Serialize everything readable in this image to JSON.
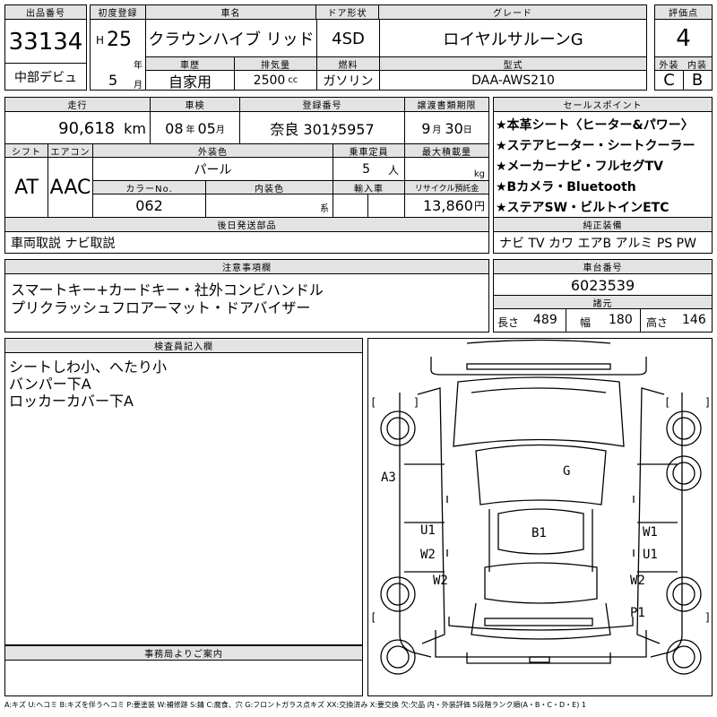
{
  "header": {
    "lot_no_label": "出品番号",
    "lot_no": "33134",
    "auction_label": "中部デビュ",
    "first_reg_label": "初度登録",
    "era": "H",
    "year": "25",
    "year_unit": "年",
    "month": "5",
    "month_unit": "月",
    "car_name_label": "車名",
    "car_name": "クラウンハイブ リッド",
    "door_label": "ドア形状",
    "door": "4SD",
    "grade_label": "グレード",
    "grade": "ロイヤルサルーンG",
    "score_label": "評価点",
    "score": "4",
    "history_label": "車歴",
    "history": "自家用",
    "displacement_label": "排気量",
    "displacement": "2500",
    "displacement_unit": "cc",
    "fuel_label": "燃料",
    "fuel": "ガソリン",
    "model_label": "型式",
    "model": "DAA-AWS210",
    "ext_score_label": "外装",
    "ext_score": "C",
    "int_score_label": "内装",
    "int_score": "B"
  },
  "info": {
    "mileage_label": "走行",
    "mileage": "90,618",
    "mileage_unit": "km",
    "inspection_label": "車検",
    "insp_year": "08",
    "insp_year_unit": "年",
    "insp_month": "05",
    "insp_month_unit": "月",
    "reg_no_label": "登録番号",
    "reg_no": "奈良 301ﾀ5957",
    "transfer_label": "譲渡書類期限",
    "transfer_month": "9",
    "transfer_month_unit": "月",
    "transfer_day": "30",
    "transfer_day_unit": "日",
    "shift_label": "シフト",
    "shift": "AT",
    "ac_label": "エアコン",
    "ac": "AAC",
    "ext_color_label": "外装色",
    "ext_color": "パール",
    "capacity_label": "乗車定員",
    "capacity": "5",
    "capacity_unit": "人",
    "load_label": "最大積載量",
    "load_unit": "kg",
    "color_no_label": "カラーNo.",
    "color_no": "062",
    "int_color_label": "内装色",
    "int_color_unit": "系",
    "import_label": "輸入車",
    "recycle_label": "リサイクル預託金",
    "recycle": "13,860",
    "recycle_unit": "円"
  },
  "sales_points": {
    "label": "セールスポイント",
    "items": [
      "★本革シート〈ヒーター&パワー〉",
      "★ステアヒーター・シートクーラー",
      "★メーカーナビ・フルセグTV",
      "★Bカメラ・Bluetooth",
      "★ステアSW・ビルトインETC"
    ]
  },
  "later_parts": {
    "label": "後日発送部品",
    "value": "車両取説 ナビ取説"
  },
  "equipment": {
    "label": "純正装備",
    "value": "ナビ TV カワ エアB アルミ PS PW"
  },
  "notes": {
    "label": "注意事項欄",
    "lines": [
      "スマートキー+カードキー・社外コンビハンドル",
      "プリクラッシュフロアーマット・ドアバイザー"
    ]
  },
  "chassis": {
    "label": "車台番号",
    "value": "6023539"
  },
  "dimensions": {
    "label": "諸元",
    "length_label": "長さ",
    "length": "489",
    "width_label": "幅",
    "width": "180",
    "height_label": "高さ",
    "height": "146"
  },
  "inspector": {
    "label": "検査員記入欄",
    "lines": [
      "シートしわ小、へたり小",
      "バンパー下A",
      "ロッカーカバー下A"
    ]
  },
  "office": {
    "label": "事務局よりご案内"
  },
  "diagram_marks": {
    "a3": "A3",
    "g": "G",
    "u1_left": "U1",
    "w2_left": "W2",
    "b1": "B1",
    "w1_right": "W1",
    "u1_right": "U1",
    "w2_left_low": "W2",
    "w2_right_low": "W2",
    "p1": "P1"
  },
  "legend": "A:キズ U:ヘコミ B:キズを伴うヘコミ P:要塗装 W:補修跡 S:錆 C:腐食、穴 G:フロントガラス点キズ XX:交換済み X:要交換 欠:欠品 内・外装評価 5段階ランク順(A・B・C・D・E) 1"
}
